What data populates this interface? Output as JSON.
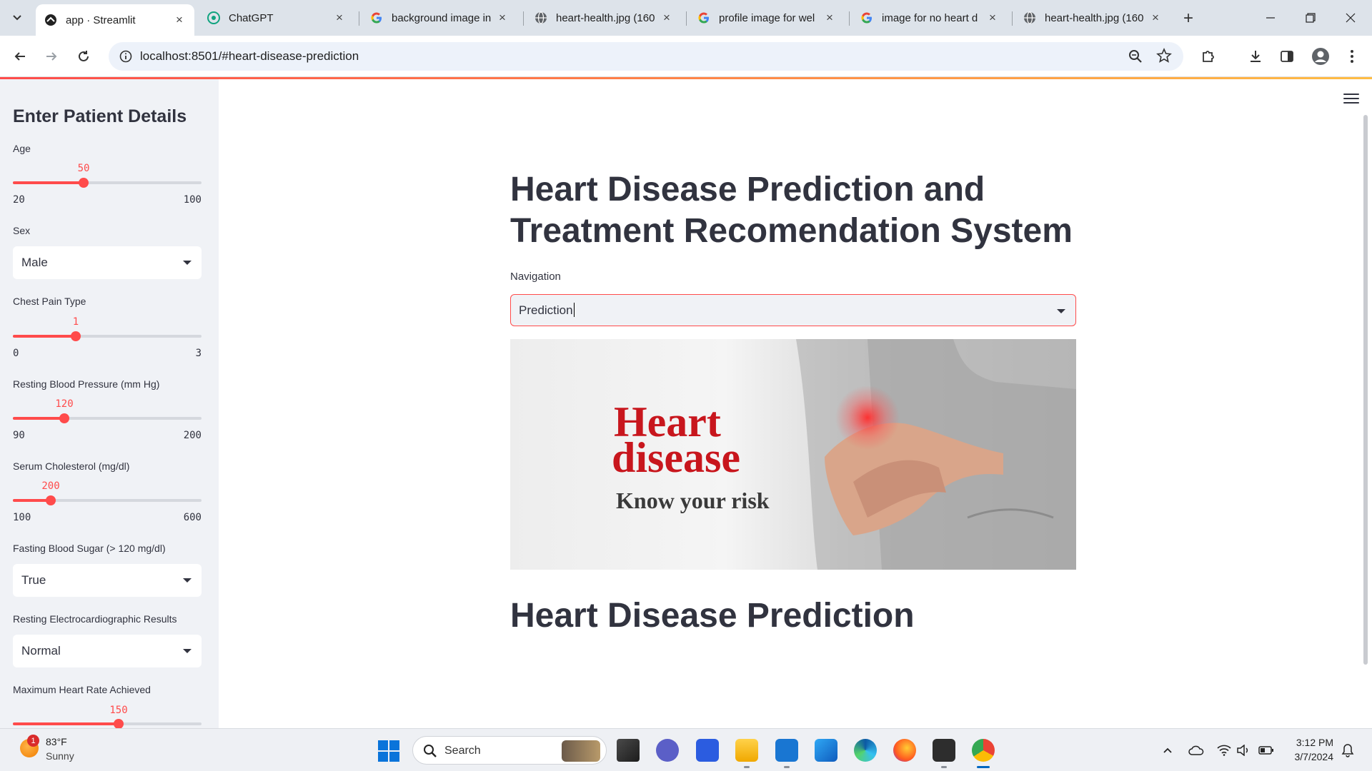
{
  "browser": {
    "tabs": [
      {
        "title": "app · Streamlit",
        "active": true,
        "favicon": "streamlit-icon"
      },
      {
        "title": "ChatGPT",
        "active": false,
        "favicon": "chatgpt-icon"
      },
      {
        "title": "background image in",
        "active": false,
        "favicon": "google-icon"
      },
      {
        "title": "heart-health.jpg (160",
        "active": false,
        "favicon": "globe-icon"
      },
      {
        "title": "profile image for wel",
        "active": false,
        "favicon": "google-icon"
      },
      {
        "title": "image for no heart d",
        "active": false,
        "favicon": "google-icon"
      },
      {
        "title": "heart-health.jpg (160",
        "active": false,
        "favicon": "globe-icon"
      }
    ],
    "url": "localhost:8501/#heart-disease-prediction"
  },
  "sidebar": {
    "title": "Enter Patient Details",
    "fields": {
      "age": {
        "label": "Age",
        "value": "50",
        "min": "20",
        "max": "100",
        "fraction": 0.375
      },
      "sex": {
        "label": "Sex",
        "value": "Male"
      },
      "cp": {
        "label": "Chest Pain Type",
        "value": "1",
        "min": "0",
        "max": "3",
        "fraction": 0.3333
      },
      "bp": {
        "label": "Resting Blood Pressure (mm Hg)",
        "value": "120",
        "min": "90",
        "max": "200",
        "fraction": 0.2727
      },
      "chol": {
        "label": "Serum Cholesterol (mg/dl)",
        "value": "200",
        "min": "100",
        "max": "600",
        "fraction": 0.2
      },
      "fbs": {
        "label": "Fasting Blood Sugar (> 120 mg/dl)",
        "value": "True"
      },
      "ecg": {
        "label": "Resting Electrocardiographic Results",
        "value": "Normal"
      },
      "hr": {
        "label": "Maximum Heart Rate Achieved",
        "value": "150",
        "fraction": 0.56
      }
    }
  },
  "main": {
    "title": "Heart Disease Prediction and Treatment Recomendation System",
    "nav_label": "Navigation",
    "nav_value": "Prediction",
    "hero": {
      "line1": "Heart",
      "line2": "disease",
      "line3": "Know your risk"
    },
    "section_title": "Heart Disease Prediction"
  },
  "taskbar": {
    "weather_badge": "1",
    "weather_temp": "83°F",
    "weather_desc": "Sunny",
    "search_placeholder": "Search",
    "time": "3:12 PM",
    "date": "3/7/2024"
  },
  "colors": {
    "accent": "#ff4b4b",
    "sidebar_bg": "#f0f2f6",
    "text": "#31333f"
  }
}
